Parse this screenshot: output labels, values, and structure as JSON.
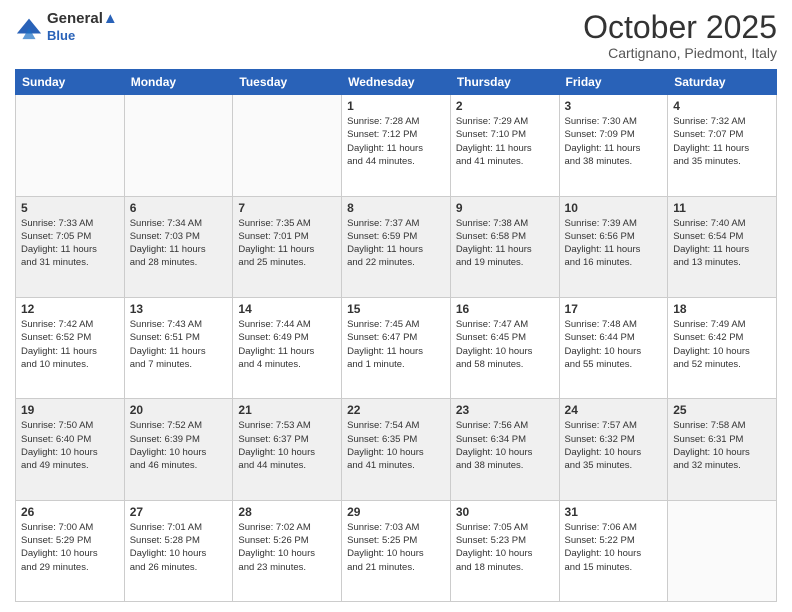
{
  "header": {
    "logo_line1": "General",
    "logo_line2": "Blue",
    "month": "October 2025",
    "location": "Cartignano, Piedmont, Italy"
  },
  "weekdays": [
    "Sunday",
    "Monday",
    "Tuesday",
    "Wednesday",
    "Thursday",
    "Friday",
    "Saturday"
  ],
  "weeks": [
    {
      "shaded": false,
      "days": [
        {
          "num": "",
          "info": ""
        },
        {
          "num": "",
          "info": ""
        },
        {
          "num": "",
          "info": ""
        },
        {
          "num": "1",
          "info": "Sunrise: 7:28 AM\nSunset: 7:12 PM\nDaylight: 11 hours\nand 44 minutes."
        },
        {
          "num": "2",
          "info": "Sunrise: 7:29 AM\nSunset: 7:10 PM\nDaylight: 11 hours\nand 41 minutes."
        },
        {
          "num": "3",
          "info": "Sunrise: 7:30 AM\nSunset: 7:09 PM\nDaylight: 11 hours\nand 38 minutes."
        },
        {
          "num": "4",
          "info": "Sunrise: 7:32 AM\nSunset: 7:07 PM\nDaylight: 11 hours\nand 35 minutes."
        }
      ]
    },
    {
      "shaded": true,
      "days": [
        {
          "num": "5",
          "info": "Sunrise: 7:33 AM\nSunset: 7:05 PM\nDaylight: 11 hours\nand 31 minutes."
        },
        {
          "num": "6",
          "info": "Sunrise: 7:34 AM\nSunset: 7:03 PM\nDaylight: 11 hours\nand 28 minutes."
        },
        {
          "num": "7",
          "info": "Sunrise: 7:35 AM\nSunset: 7:01 PM\nDaylight: 11 hours\nand 25 minutes."
        },
        {
          "num": "8",
          "info": "Sunrise: 7:37 AM\nSunset: 6:59 PM\nDaylight: 11 hours\nand 22 minutes."
        },
        {
          "num": "9",
          "info": "Sunrise: 7:38 AM\nSunset: 6:58 PM\nDaylight: 11 hours\nand 19 minutes."
        },
        {
          "num": "10",
          "info": "Sunrise: 7:39 AM\nSunset: 6:56 PM\nDaylight: 11 hours\nand 16 minutes."
        },
        {
          "num": "11",
          "info": "Sunrise: 7:40 AM\nSunset: 6:54 PM\nDaylight: 11 hours\nand 13 minutes."
        }
      ]
    },
    {
      "shaded": false,
      "days": [
        {
          "num": "12",
          "info": "Sunrise: 7:42 AM\nSunset: 6:52 PM\nDaylight: 11 hours\nand 10 minutes."
        },
        {
          "num": "13",
          "info": "Sunrise: 7:43 AM\nSunset: 6:51 PM\nDaylight: 11 hours\nand 7 minutes."
        },
        {
          "num": "14",
          "info": "Sunrise: 7:44 AM\nSunset: 6:49 PM\nDaylight: 11 hours\nand 4 minutes."
        },
        {
          "num": "15",
          "info": "Sunrise: 7:45 AM\nSunset: 6:47 PM\nDaylight: 11 hours\nand 1 minute."
        },
        {
          "num": "16",
          "info": "Sunrise: 7:47 AM\nSunset: 6:45 PM\nDaylight: 10 hours\nand 58 minutes."
        },
        {
          "num": "17",
          "info": "Sunrise: 7:48 AM\nSunset: 6:44 PM\nDaylight: 10 hours\nand 55 minutes."
        },
        {
          "num": "18",
          "info": "Sunrise: 7:49 AM\nSunset: 6:42 PM\nDaylight: 10 hours\nand 52 minutes."
        }
      ]
    },
    {
      "shaded": true,
      "days": [
        {
          "num": "19",
          "info": "Sunrise: 7:50 AM\nSunset: 6:40 PM\nDaylight: 10 hours\nand 49 minutes."
        },
        {
          "num": "20",
          "info": "Sunrise: 7:52 AM\nSunset: 6:39 PM\nDaylight: 10 hours\nand 46 minutes."
        },
        {
          "num": "21",
          "info": "Sunrise: 7:53 AM\nSunset: 6:37 PM\nDaylight: 10 hours\nand 44 minutes."
        },
        {
          "num": "22",
          "info": "Sunrise: 7:54 AM\nSunset: 6:35 PM\nDaylight: 10 hours\nand 41 minutes."
        },
        {
          "num": "23",
          "info": "Sunrise: 7:56 AM\nSunset: 6:34 PM\nDaylight: 10 hours\nand 38 minutes."
        },
        {
          "num": "24",
          "info": "Sunrise: 7:57 AM\nSunset: 6:32 PM\nDaylight: 10 hours\nand 35 minutes."
        },
        {
          "num": "25",
          "info": "Sunrise: 7:58 AM\nSunset: 6:31 PM\nDaylight: 10 hours\nand 32 minutes."
        }
      ]
    },
    {
      "shaded": false,
      "days": [
        {
          "num": "26",
          "info": "Sunrise: 7:00 AM\nSunset: 5:29 PM\nDaylight: 10 hours\nand 29 minutes."
        },
        {
          "num": "27",
          "info": "Sunrise: 7:01 AM\nSunset: 5:28 PM\nDaylight: 10 hours\nand 26 minutes."
        },
        {
          "num": "28",
          "info": "Sunrise: 7:02 AM\nSunset: 5:26 PM\nDaylight: 10 hours\nand 23 minutes."
        },
        {
          "num": "29",
          "info": "Sunrise: 7:03 AM\nSunset: 5:25 PM\nDaylight: 10 hours\nand 21 minutes."
        },
        {
          "num": "30",
          "info": "Sunrise: 7:05 AM\nSunset: 5:23 PM\nDaylight: 10 hours\nand 18 minutes."
        },
        {
          "num": "31",
          "info": "Sunrise: 7:06 AM\nSunset: 5:22 PM\nDaylight: 10 hours\nand 15 minutes."
        },
        {
          "num": "",
          "info": ""
        }
      ]
    }
  ]
}
